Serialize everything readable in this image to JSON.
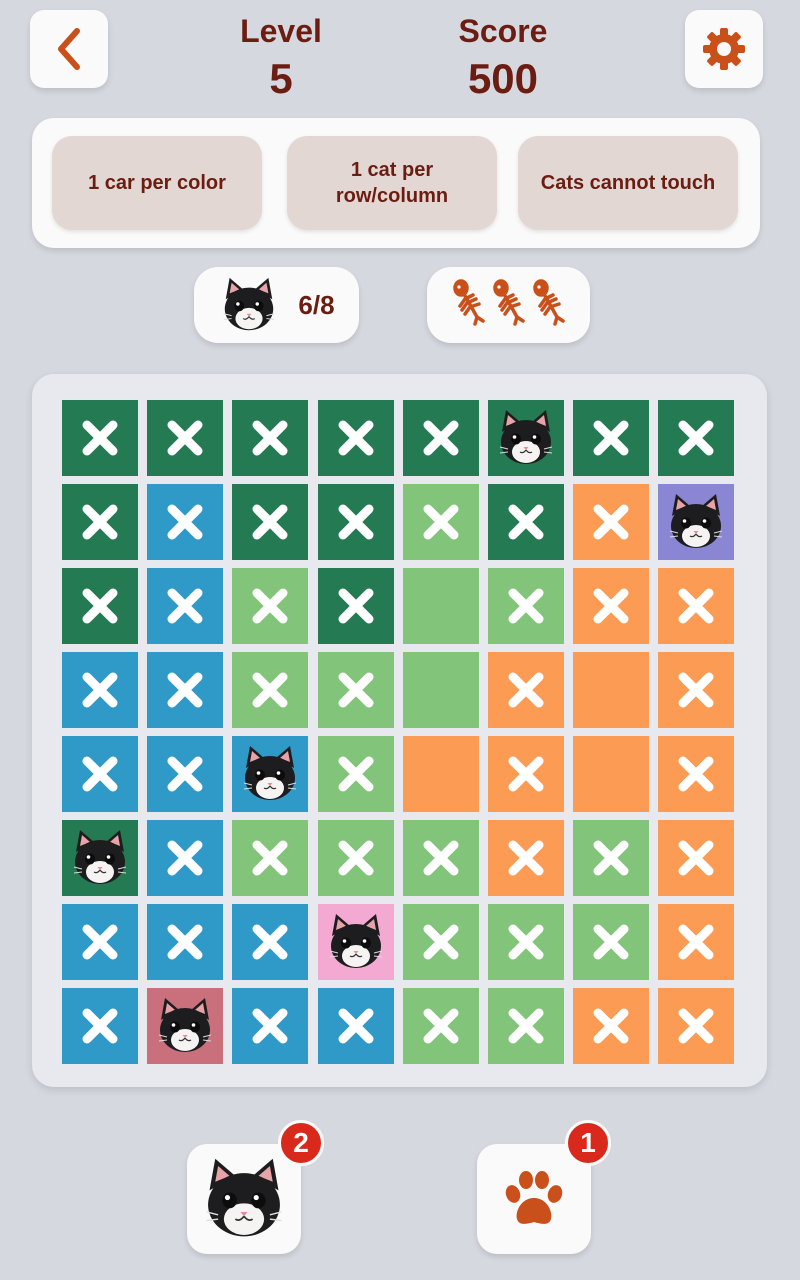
{
  "header": {
    "level_label": "Level",
    "level_value": "5",
    "score_label": "Score",
    "score_value": "500",
    "back_icon": "chevron-left-icon",
    "settings_icon": "gear-icon"
  },
  "rules": [
    {
      "text": "1 car per color"
    },
    {
      "text": "1 cat per\nrow/column"
    },
    {
      "text": "Cats cannot touch"
    }
  ],
  "status": {
    "cats_placed": "6/8",
    "lives_icon": "fishbone-icon",
    "lives": 3
  },
  "colors": {
    "dark_green": "#247a52",
    "blue": "#2f9ac8",
    "light_green": "#82c479",
    "orange": "#fb9b54",
    "purple": "#8a86d3",
    "pink": "#f4a9d3",
    "rose": "#c9707c",
    "accent": "#c9501a",
    "text": "#6b1d12",
    "badge": "#d9281c"
  },
  "board": {
    "rows": [
      [
        {
          "c": "DG",
          "m": "x"
        },
        {
          "c": "DG",
          "m": "x"
        },
        {
          "c": "DG",
          "m": "x"
        },
        {
          "c": "DG",
          "m": "x"
        },
        {
          "c": "DG",
          "m": "x"
        },
        {
          "c": "DG",
          "m": "cat"
        },
        {
          "c": "DG",
          "m": "x"
        },
        {
          "c": "DG",
          "m": "x"
        }
      ],
      [
        {
          "c": "DG",
          "m": "x"
        },
        {
          "c": "B",
          "m": "x"
        },
        {
          "c": "DG",
          "m": "x"
        },
        {
          "c": "DG",
          "m": "x"
        },
        {
          "c": "LG",
          "m": "x"
        },
        {
          "c": "DG",
          "m": "x"
        },
        {
          "c": "O",
          "m": "x"
        },
        {
          "c": "P",
          "m": "cat"
        }
      ],
      [
        {
          "c": "DG",
          "m": "x"
        },
        {
          "c": "B",
          "m": "x"
        },
        {
          "c": "LG",
          "m": "x"
        },
        {
          "c": "DG",
          "m": "x"
        },
        {
          "c": "LG",
          "m": ""
        },
        {
          "c": "LG",
          "m": "x"
        },
        {
          "c": "O",
          "m": "x"
        },
        {
          "c": "O",
          "m": "x"
        }
      ],
      [
        {
          "c": "B",
          "m": "x"
        },
        {
          "c": "B",
          "m": "x"
        },
        {
          "c": "LG",
          "m": "x"
        },
        {
          "c": "LG",
          "m": "x"
        },
        {
          "c": "LG",
          "m": ""
        },
        {
          "c": "O",
          "m": "x"
        },
        {
          "c": "O",
          "m": ""
        },
        {
          "c": "O",
          "m": "x"
        }
      ],
      [
        {
          "c": "B",
          "m": "x"
        },
        {
          "c": "B",
          "m": "x"
        },
        {
          "c": "B",
          "m": "cat"
        },
        {
          "c": "LG",
          "m": "x"
        },
        {
          "c": "O",
          "m": ""
        },
        {
          "c": "O",
          "m": "x"
        },
        {
          "c": "O",
          "m": ""
        },
        {
          "c": "O",
          "m": "x"
        }
      ],
      [
        {
          "c": "DG",
          "m": "cat"
        },
        {
          "c": "B",
          "m": "x"
        },
        {
          "c": "LG",
          "m": "x"
        },
        {
          "c": "LG",
          "m": "x"
        },
        {
          "c": "LG",
          "m": "x"
        },
        {
          "c": "O",
          "m": "x"
        },
        {
          "c": "LG",
          "m": "x"
        },
        {
          "c": "O",
          "m": "x"
        }
      ],
      [
        {
          "c": "B",
          "m": "x"
        },
        {
          "c": "B",
          "m": "x"
        },
        {
          "c": "B",
          "m": "x"
        },
        {
          "c": "PK",
          "m": "cat"
        },
        {
          "c": "LG",
          "m": "x"
        },
        {
          "c": "LG",
          "m": "x"
        },
        {
          "c": "LG",
          "m": "x"
        },
        {
          "c": "O",
          "m": "x"
        }
      ],
      [
        {
          "c": "B",
          "m": "x"
        },
        {
          "c": "R",
          "m": "cat"
        },
        {
          "c": "B",
          "m": "x"
        },
        {
          "c": "B",
          "m": "x"
        },
        {
          "c": "LG",
          "m": "x"
        },
        {
          "c": "LG",
          "m": "x"
        },
        {
          "c": "O",
          "m": "x"
        },
        {
          "c": "O",
          "m": "x"
        }
      ]
    ]
  },
  "powerups": [
    {
      "name": "cat-hint",
      "icon": "cat-face-icon",
      "count": "2"
    },
    {
      "name": "paw-hint",
      "icon": "paw-icon",
      "count": "1"
    }
  ]
}
